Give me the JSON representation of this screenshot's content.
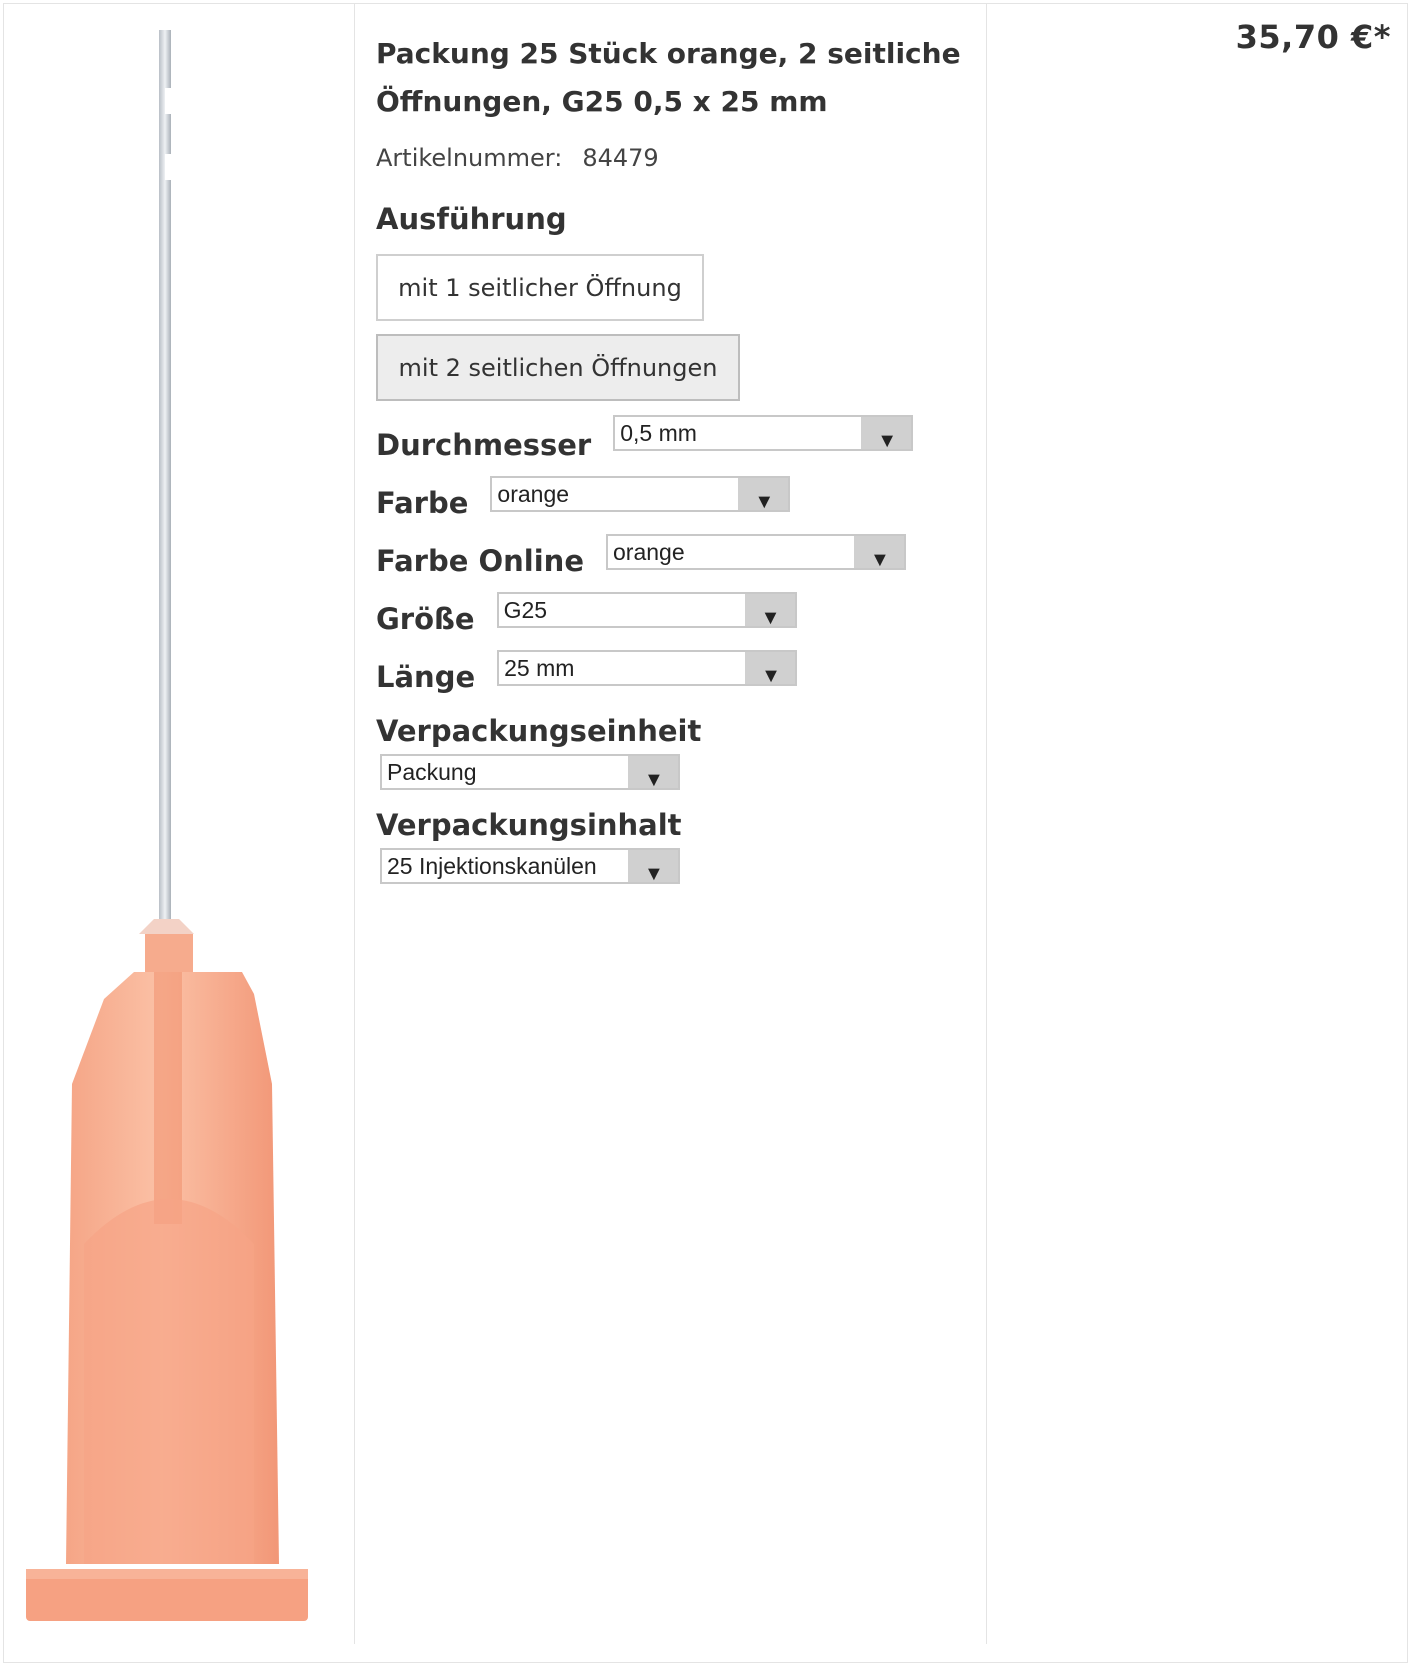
{
  "product": {
    "title": "Packung 25 Stück orange, 2 seitliche Öffnungen, G25 0,5 x 25 mm",
    "article_label": "Artikelnummer:",
    "article_number": "84479",
    "price": "35,70 €*"
  },
  "variant": {
    "heading": "Ausführung",
    "options": [
      "mit 1 seitlicher Öffnung",
      "mit 2 seitlichen Öffnungen"
    ],
    "selected": "mit 2 seitlichen Öffnungen"
  },
  "selects": [
    {
      "label": "Durchmesser",
      "value": "0,5 mm"
    },
    {
      "label": "Farbe",
      "value": "orange"
    },
    {
      "label": "Farbe Online",
      "value": "orange"
    },
    {
      "label": "Größe",
      "value": "G25"
    },
    {
      "label": "Länge",
      "value": "25 mm"
    },
    {
      "label": "Verpackungseinheit",
      "value": "Packung"
    },
    {
      "label": "Verpackungsinhalt",
      "value": "25 Injektionskanülen"
    }
  ],
  "colors": {
    "hub": "#f7a88a",
    "needle": "#c7cdd3",
    "border": "#e4e4e4"
  },
  "icons": {
    "dropdown": "dropdown-arrow-icon"
  }
}
